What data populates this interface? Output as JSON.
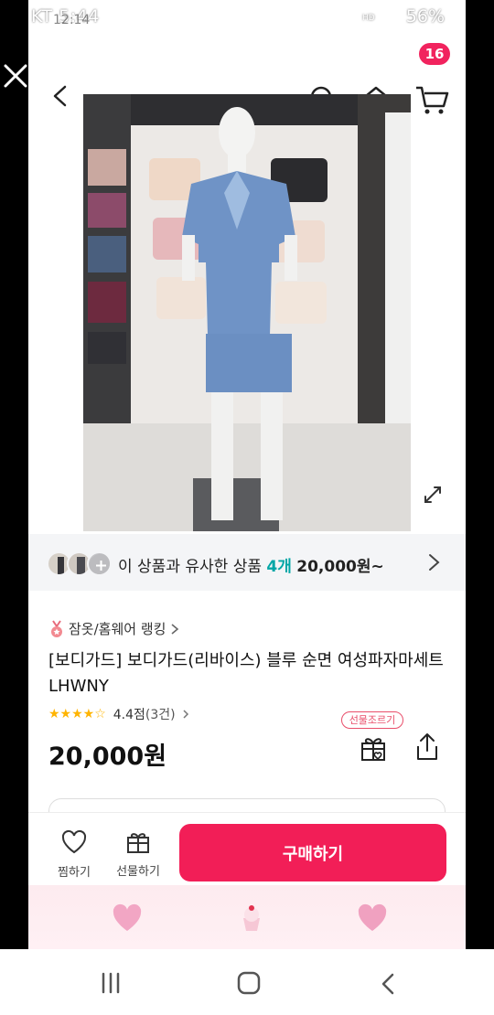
{
  "status_bar": {
    "left": "KT 5:44",
    "ghost": "12:14",
    "right": "56%"
  },
  "header": {
    "cart_count": "16",
    "icons": [
      "close-icon",
      "back-icon",
      "search-icon",
      "home-icon",
      "cart-icon"
    ]
  },
  "similar": {
    "text": "이 상품과 유사한 상품",
    "count": "4개",
    "price": "20,000원~"
  },
  "product": {
    "ranking": "잠옷/홈웨어 랭킹",
    "title": "[보디가드] 보디가드(리바이스) 블루 순면  여성파자마세트LHWNY",
    "rating_text": "4.4점",
    "review_count": "(3건)",
    "price": "20,000원",
    "gift_tag": "선물조르기"
  },
  "bottom_bar": {
    "wish_label": "찜하기",
    "gift_label": "선물하기",
    "buy_label": "구매하기"
  },
  "colors": {
    "accent": "#f21e57",
    "badge": "#f1235e",
    "teal": "#00a6a6",
    "star": "#ffb400"
  }
}
